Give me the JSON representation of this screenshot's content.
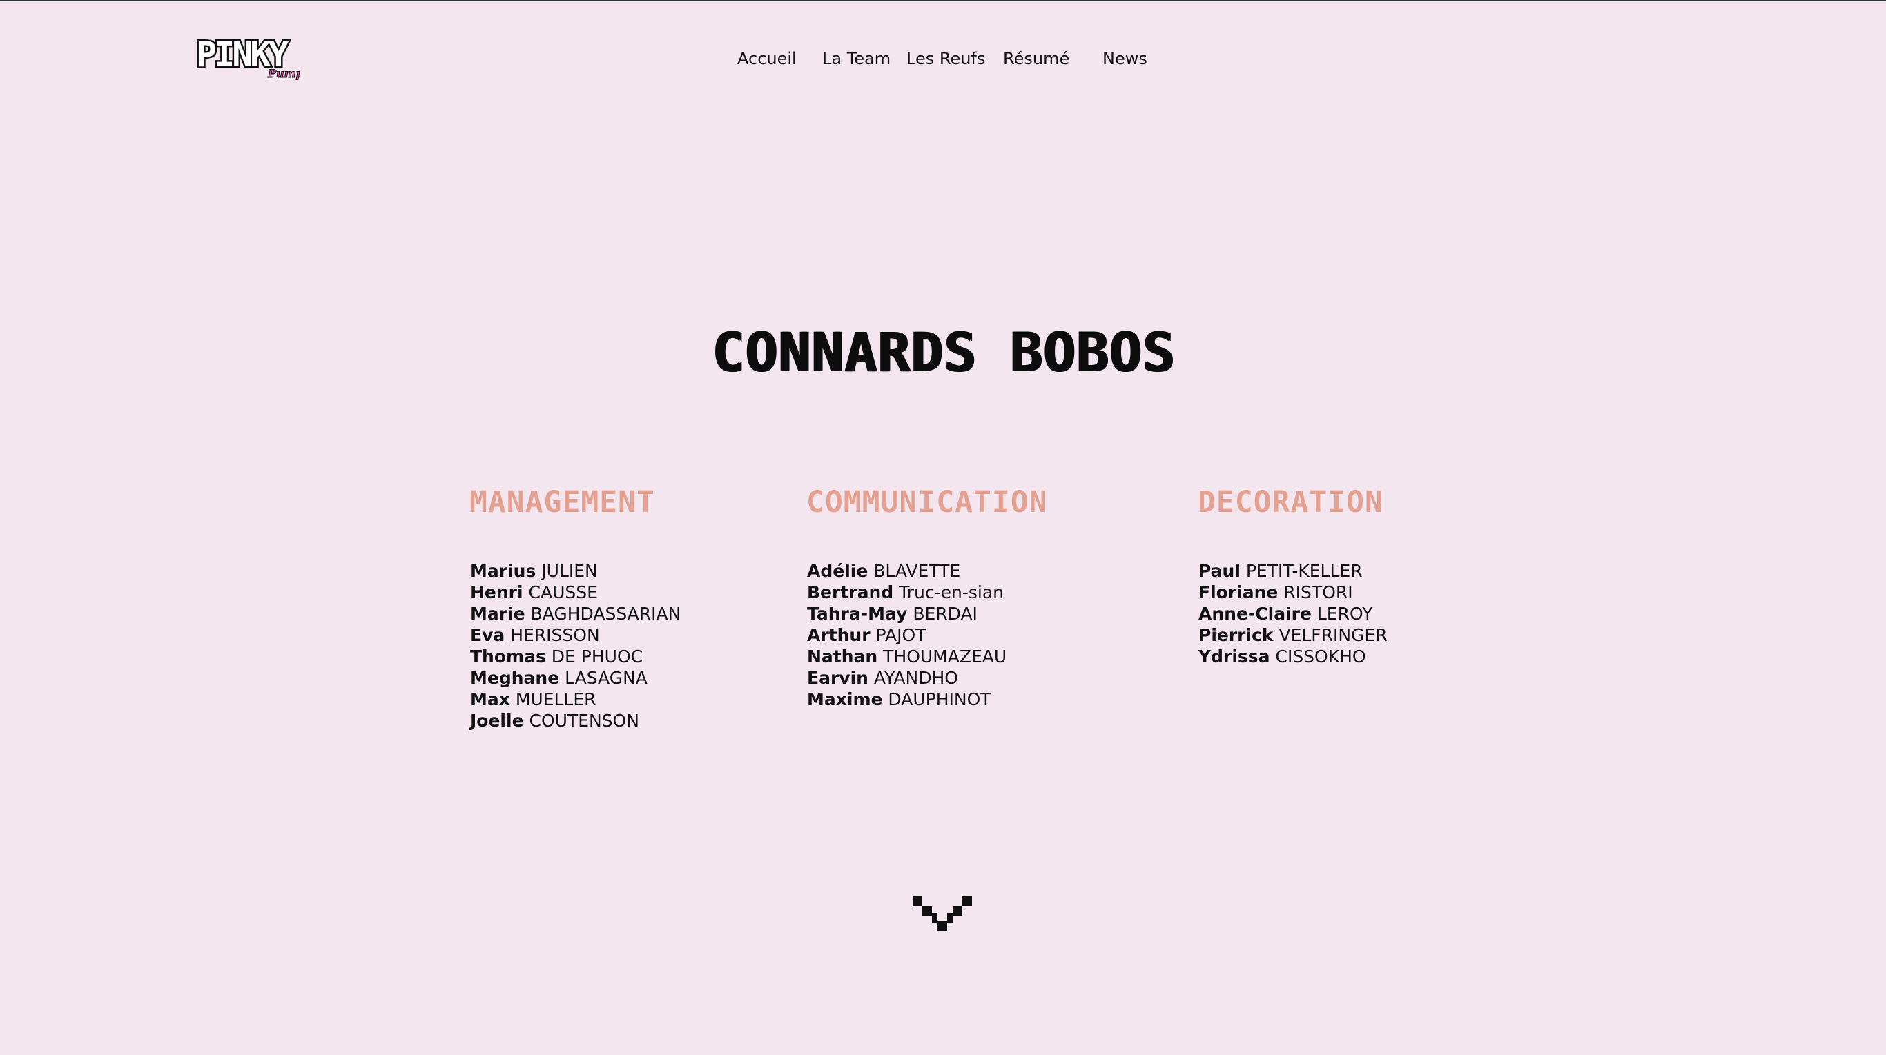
{
  "brand": {
    "logo_text": "PINKY",
    "logo_subtext": "Pump",
    "accent": "#e85cb0"
  },
  "nav": {
    "items": [
      {
        "label": "Accueil"
      },
      {
        "label": "La Team"
      },
      {
        "label": "Les Reufs"
      },
      {
        "label": "Résumé"
      },
      {
        "label": "News"
      }
    ]
  },
  "page": {
    "title": "CONNARDS BOBOS",
    "background": "#f4e6ef",
    "heading_color": "#e4a090"
  },
  "teams": [
    {
      "name": "MANAGEMENT",
      "members": [
        {
          "first": "Marius",
          "last": "JULIEN"
        },
        {
          "first": "Henri",
          "last": "CAUSSE"
        },
        {
          "first": "Marie",
          "last": "BAGHDASSARIAN"
        },
        {
          "first": "Eva",
          "last": "HERISSON"
        },
        {
          "first": "Thomas",
          "last": "DE PHUOC"
        },
        {
          "first": "Meghane",
          "last": "LASAGNA"
        },
        {
          "first": "Max",
          "last": "MUELLER"
        },
        {
          "first": "Joelle",
          "last": "COUTENSON"
        }
      ]
    },
    {
      "name": "COMMUNICATION",
      "members": [
        {
          "first": "Adélie",
          "last": "BLAVETTE"
        },
        {
          "first": "Bertrand",
          "last": "Truc-en-sian"
        },
        {
          "first": "Tahra-May",
          "last": "BERDAI"
        },
        {
          "first": "Arthur",
          "last": "PAJOT"
        },
        {
          "first": "Nathan",
          "last": "THOUMAZEAU"
        },
        {
          "first": "Earvin",
          "last": "AYANDHO"
        },
        {
          "first": "Maxime",
          "last": "DAUPHINOT"
        }
      ]
    },
    {
      "name": "DECORATION",
      "members": [
        {
          "first": "Paul",
          "last": "PETIT-KELLER"
        },
        {
          "first": "Floriane",
          "last": "RISTORI"
        },
        {
          "first": "Anne-Claire",
          "last": "LEROY"
        },
        {
          "first": "Pierrick",
          "last": "VELFRINGER"
        },
        {
          "first": "Ydrissa",
          "last": "CISSOKHO"
        }
      ]
    }
  ],
  "scroll": {
    "icon": "pixel-chevron-down-icon"
  }
}
